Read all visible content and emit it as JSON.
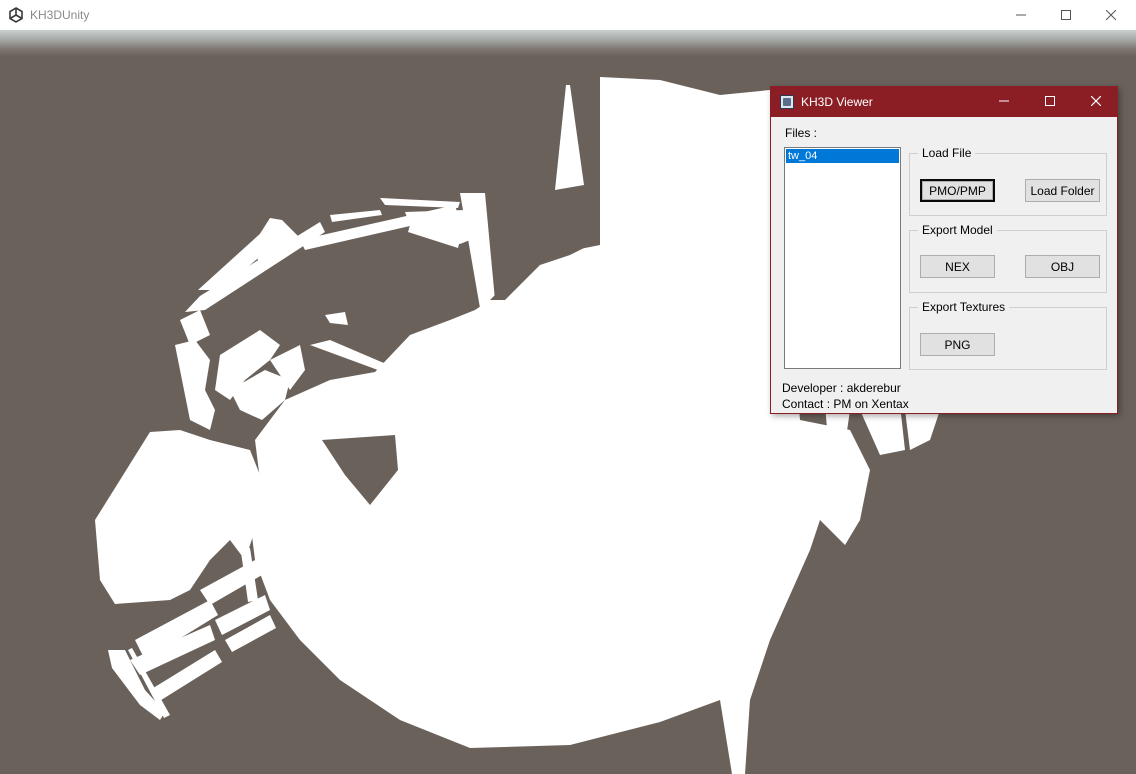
{
  "app": {
    "title": "KH3DUnity",
    "window_controls": [
      "minimize-icon",
      "maximize-icon",
      "close-icon"
    ]
  },
  "viewer_dialog": {
    "title": "KH3D Viewer",
    "files_label": "Files :",
    "files": [
      {
        "name": "tw_04",
        "selected": true
      }
    ],
    "load_file": {
      "title": "Load File",
      "pmo_pmp_button": "PMO/PMP",
      "load_folder_button": "Load Folder"
    },
    "export_model": {
      "title": "Export Model",
      "nex_button": "NEX",
      "obj_button": "OBJ"
    },
    "export_textures": {
      "title": "Export Textures",
      "png_button": "PNG"
    },
    "developer_text": "Developer : akderebur",
    "contact_text": "Contact : PM on Xentax"
  },
  "colors": {
    "background": "#6a615b",
    "model": "#ffffff",
    "dialog_titlebar": "#8b1e24",
    "selection": "#0078d7"
  }
}
